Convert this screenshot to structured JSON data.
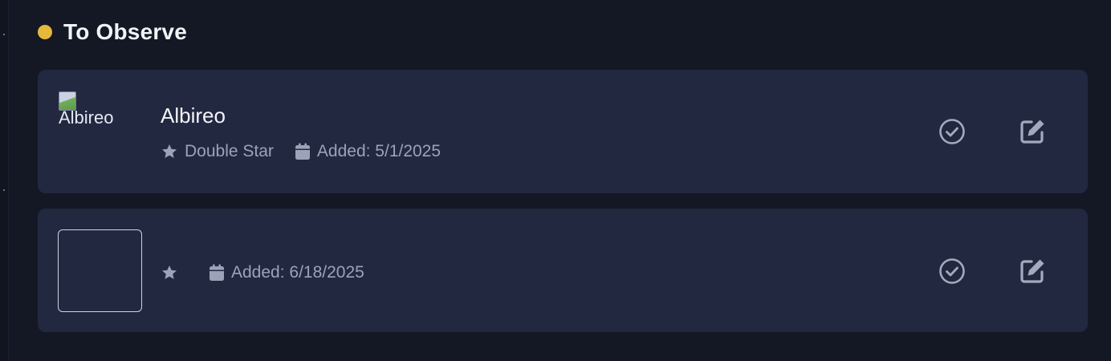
{
  "section": {
    "title": "To Observe",
    "dot_color": "#e6b93c"
  },
  "items": [
    {
      "name": "Albireo",
      "image_alt": "Albireo",
      "type": "Double Star",
      "added": "Added: 5/1/2025",
      "actions": [
        "check-circle-icon",
        "edit-icon"
      ]
    },
    {
      "name": "",
      "image_alt": "",
      "type": "",
      "added": "Added: 6/18/2025",
      "actions": [
        "check-circle-icon",
        "edit-icon"
      ]
    }
  ],
  "colors": {
    "background": "#141824",
    "card": "#222840",
    "meta_text": "#9ba3b8",
    "icon": "#a3aabd"
  }
}
